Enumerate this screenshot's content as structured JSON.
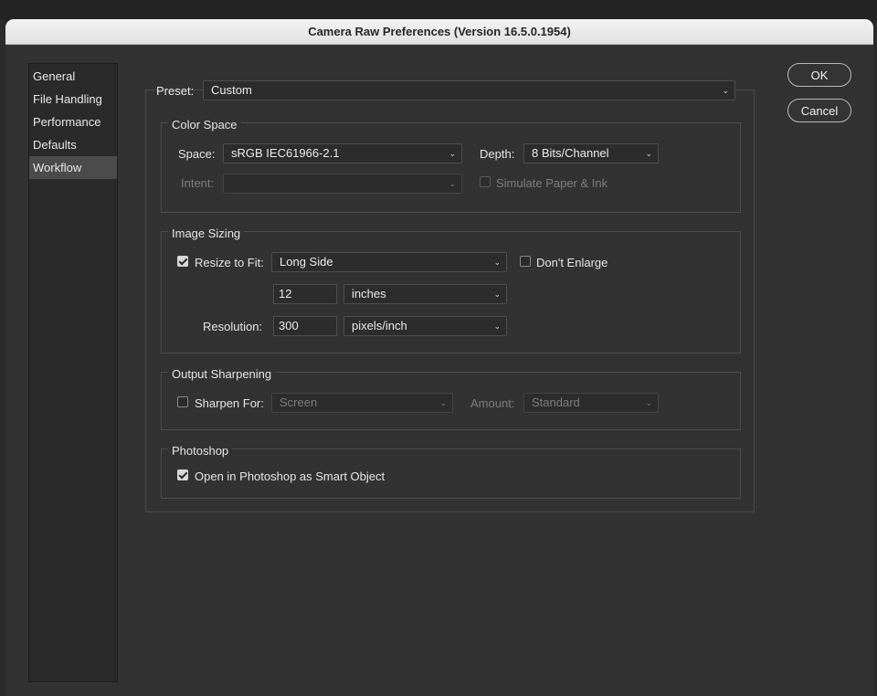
{
  "window": {
    "title": "Camera Raw Preferences  (Version 16.5.0.1954)"
  },
  "sidebar": {
    "items": [
      {
        "label": "General"
      },
      {
        "label": "File Handling"
      },
      {
        "label": "Performance"
      },
      {
        "label": "Defaults"
      },
      {
        "label": "Workflow",
        "selected": true
      }
    ]
  },
  "buttons": {
    "ok": "OK",
    "cancel": "Cancel"
  },
  "preset": {
    "label": "Preset:",
    "value": "Custom"
  },
  "color_space": {
    "title": "Color Space",
    "space_label": "Space:",
    "space_value": "sRGB IEC61966-2.1",
    "depth_label": "Depth:",
    "depth_value": "8 Bits/Channel",
    "intent_label": "Intent:",
    "intent_value": "",
    "simulate_label": "Simulate Paper & Ink",
    "simulate_checked": false
  },
  "image_sizing": {
    "title": "Image Sizing",
    "resize_label": "Resize to Fit:",
    "resize_checked": true,
    "resize_value": "Long Side",
    "dont_enlarge_label": "Don't Enlarge",
    "dont_enlarge_checked": false,
    "size_value": "12",
    "size_unit": "inches",
    "resolution_label": "Resolution:",
    "resolution_value": "300",
    "resolution_unit": "pixels/inch"
  },
  "output_sharpening": {
    "title": "Output Sharpening",
    "sharpen_label": "Sharpen For:",
    "sharpen_checked": false,
    "sharpen_value": "Screen",
    "amount_label": "Amount:",
    "amount_value": "Standard"
  },
  "photoshop": {
    "title": "Photoshop",
    "smart_object_label": "Open in Photoshop as Smart Object",
    "smart_object_checked": true
  },
  "icons": {
    "dropdown": "chevron-down-icon",
    "checkbox": "checkbox-icon"
  },
  "colors": {
    "background": "#323232",
    "titlebar": "#e8e8e8",
    "selected_item": "#4b4b4b"
  }
}
